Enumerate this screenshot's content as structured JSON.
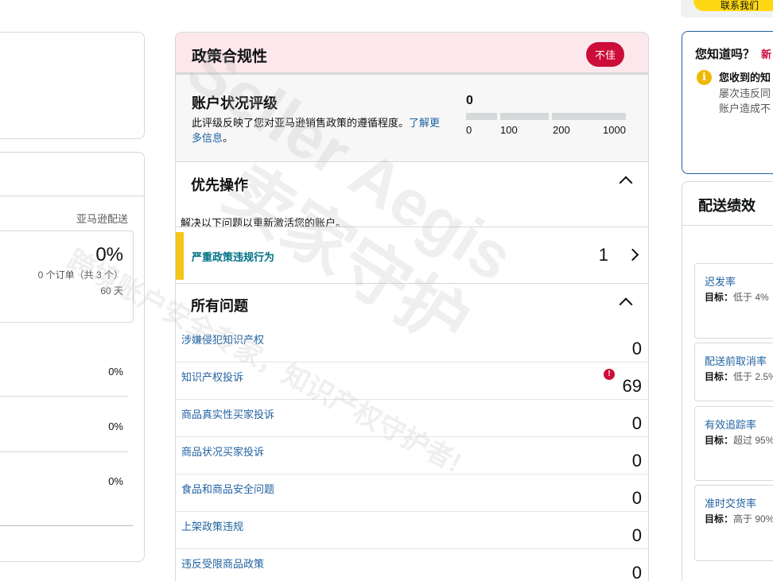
{
  "left": {
    "delivery_label": "亚马逊配送",
    "main_percent": "0%",
    "orders_text": "0 个订单（共 3 个）",
    "days_text": "60 天",
    "rows": [
      "0%",
      "0%",
      "0%"
    ]
  },
  "policy": {
    "title": "政策合规性",
    "badge": "不佳",
    "account_status": {
      "title": "账户状况评级",
      "desc": "此评级反映了您对亚马逊销售政策的遵循程度。",
      "link": "了解更多信息",
      "desc_end": "。",
      "score": "0",
      "scale": [
        "0",
        "100",
        "200",
        "1000"
      ]
    },
    "priority": {
      "title": "优先操作",
      "desc": "解决以下问题以重新激活您的账户。",
      "item_label": "严重政策违规行为",
      "item_count": "1"
    },
    "all_issues": {
      "title": "所有问题",
      "items": [
        {
          "label": "涉嫌侵犯知识产权",
          "count": "0"
        },
        {
          "label": "知识产权投诉",
          "count": "69"
        },
        {
          "label": "商品真实性买家投诉",
          "count": "0"
        },
        {
          "label": "商品状况买家投诉",
          "count": "0"
        },
        {
          "label": "食品和商品安全问题",
          "count": "0"
        },
        {
          "label": "上架政策违规",
          "count": "0"
        },
        {
          "label": "违反受限商品政策",
          "count": "0"
        }
      ],
      "alert_mark": "!"
    }
  },
  "right": {
    "top_button": "联系我们",
    "did_you_know": {
      "title": "您知道吗？",
      "new_tag": "新",
      "icon": "i",
      "line1": "您收到的知",
      "line2": "屡次违反同",
      "line3": "账户造成不"
    },
    "shipping": {
      "title": "配送绩效",
      "metrics": [
        {
          "name": "迟发率",
          "target_label": "目标：",
          "target": "低于 4%"
        },
        {
          "name": "配送前取消率",
          "target_label": "目标：",
          "target": "低于 2.5%"
        },
        {
          "name": "有效追踪率",
          "target_label": "目标：",
          "target": "超过 95%"
        },
        {
          "name": "准时交货率",
          "target_label": "目标：",
          "target": "高于 90%"
        }
      ]
    }
  },
  "watermark": {
    "brand": "Seller Aegis",
    "cn_name": "卖家守护",
    "tagline": "跨境账户安全专家，知识产权守护者!"
  },
  "colors": {
    "badge": "#cc0c39",
    "link": "#2162a1",
    "teal": "#007185",
    "yellow": "#f5c518",
    "header_pink": "#fce8ec"
  }
}
